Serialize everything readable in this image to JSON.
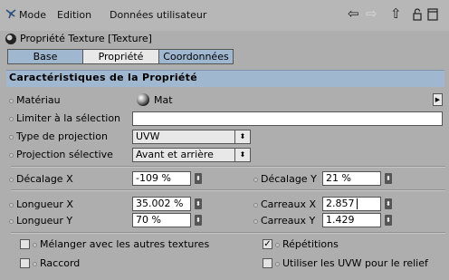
{
  "menu": {
    "icon": "cinema-4d-icon",
    "items": [
      "Mode",
      "Edition",
      "Données utilisateur"
    ]
  },
  "title": "Propriété Texture [Texture]",
  "tabs": [
    {
      "label": "Base",
      "selected": false
    },
    {
      "label": "Propriété",
      "selected": true
    },
    {
      "label": "Coordonnées",
      "selected": false
    }
  ],
  "section": "Caractéristiques de la Propriété",
  "fields": {
    "materiau": {
      "label": "Matériau",
      "value": "Mat"
    },
    "limiter": {
      "label": "Limiter à la sélection",
      "value": ""
    },
    "type_projection": {
      "label": "Type de projection",
      "value": "UVW"
    },
    "projection_selective": {
      "label": "Projection sélective",
      "value": "Avant et arrière"
    },
    "decalage_x": {
      "label": "Décalage X",
      "value": "-109 %"
    },
    "decalage_y": {
      "label": "Décalage Y",
      "value": "21 %"
    },
    "longueur_x": {
      "label": "Longueur X",
      "value": "35.002 %"
    },
    "carreaux_x": {
      "label": "Carreaux X",
      "value": "2.857"
    },
    "longueur_y": {
      "label": "Longueur Y",
      "value": "70 %"
    },
    "carreaux_y": {
      "label": "Carreaux Y",
      "value": "1.429"
    }
  },
  "checkboxes": {
    "melanger": {
      "label": "Mélanger avec les autres textures",
      "checked": false
    },
    "repetitions": {
      "label": "Répétitions",
      "checked": true
    },
    "raccord": {
      "label": "Raccord",
      "checked": false
    },
    "utiliser_uvw": {
      "label": "Utiliser les UVW pour le relief",
      "checked": false
    }
  },
  "colors": {
    "tab_selected": "#e8e8e8",
    "tab_unselected": "#a0b7d0",
    "background": "#aeaeae"
  }
}
